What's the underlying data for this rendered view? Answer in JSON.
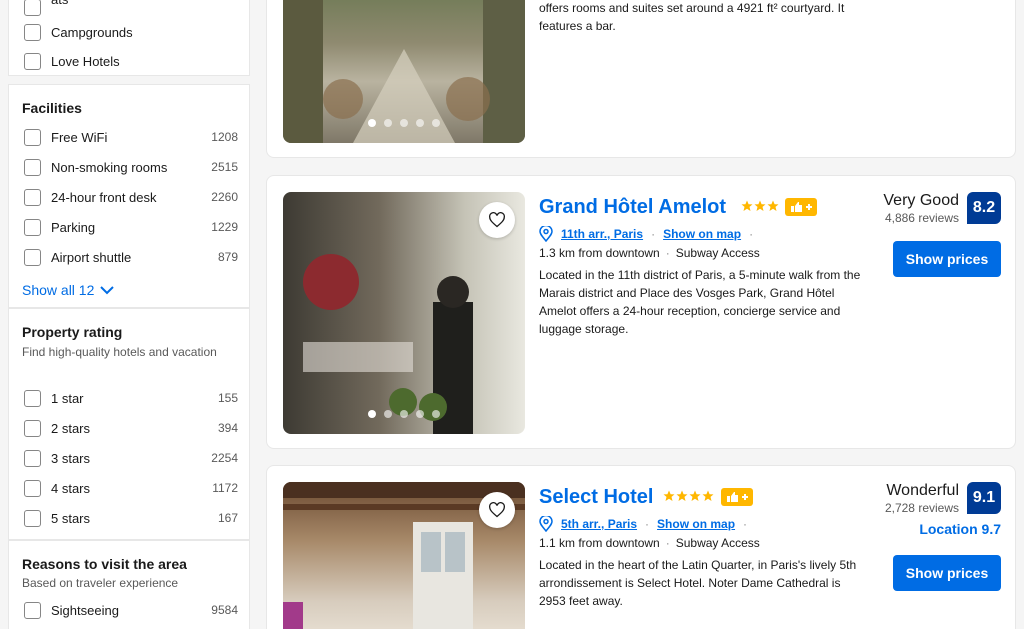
{
  "sidebar": {
    "types_top": [
      {
        "label": "ats",
        "count": ""
      },
      {
        "label": "Campgrounds",
        "count": ""
      },
      {
        "label": "Love Hotels",
        "count": ""
      }
    ],
    "facilities": {
      "title": "Facilities",
      "items": [
        {
          "label": "Free WiFi",
          "count": "1208"
        },
        {
          "label": "Non-smoking rooms",
          "count": "2515"
        },
        {
          "label": "24-hour front desk",
          "count": "2260"
        },
        {
          "label": "Parking",
          "count": "1229"
        },
        {
          "label": "Airport shuttle",
          "count": "879"
        }
      ],
      "show_all": "Show all 12"
    },
    "property_rating": {
      "title": "Property rating",
      "subtitle": "Find high-quality hotels and vacation rentals",
      "items": [
        {
          "label": "1 star",
          "count": "155"
        },
        {
          "label": "2 stars",
          "count": "394"
        },
        {
          "label": "3 stars",
          "count": "2254"
        },
        {
          "label": "4 stars",
          "count": "1172"
        },
        {
          "label": "5 stars",
          "count": "167"
        }
      ]
    },
    "reasons": {
      "title": "Reasons to visit the area",
      "subtitle": "Based on traveler experience",
      "items": [
        {
          "label": "Sightseeing",
          "count": "9584"
        }
      ]
    }
  },
  "top_card": {
    "desc": "offers rooms and suites set around a 4921 ft² courtyard. It features a bar."
  },
  "hotels": [
    {
      "name": "Grand Hôtel Amelot",
      "stars": 3,
      "area": "11th arr., Paris",
      "map_link": "Show on map",
      "distance": "1.3 km from downtown",
      "transit": "Subway Access",
      "desc": "Located in the 11th district of Paris, a 5-minute walk from the Marais district and Place des Vosges Park, Grand Hôtel Amelot offers a 24-hour reception, concierge service and luggage storage.",
      "rating_word": "Very Good",
      "reviews": "4,886 reviews",
      "score": "8.2",
      "location_score": "",
      "cta": "Show prices"
    },
    {
      "name": "Select Hotel",
      "stars": 4,
      "area": "5th arr., Paris",
      "map_link": "Show on map",
      "distance": "1.1 km from downtown",
      "transit": "Subway Access",
      "desc": "Located in the heart of the Latin Quarter, in Paris's lively 5th arrondissement is Select Hotel. Noter Dame Cathedral is 2953 feet away.",
      "rating_word": "Wonderful",
      "reviews": "2,728 reviews",
      "score": "9.1",
      "location_score": "Location 9.7",
      "cta": "Show prices"
    }
  ],
  "colors": {
    "brand_blue": "#006ce4",
    "score_blue": "#003b95",
    "star_yellow": "#ffb700"
  }
}
